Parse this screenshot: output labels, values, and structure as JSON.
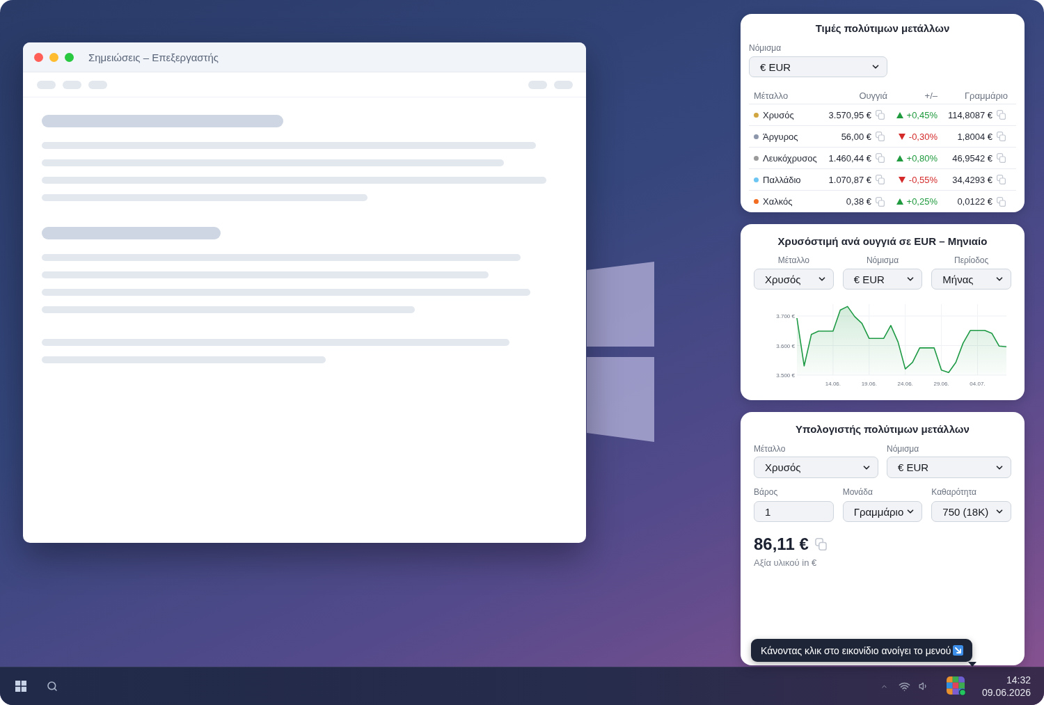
{
  "window": {
    "title": "Σημειώσεις – Επεξεργαστής"
  },
  "prices": {
    "title": "Τιμές πολύτιμων μετάλλων",
    "currency": {
      "label": "Νόμισμα",
      "value": "€ EUR"
    },
    "columns": [
      "Μέταλλο",
      "Ουγγιά",
      "+/–",
      "Γραμμάριο"
    ],
    "rows": [
      {
        "metal": "Χρυσός",
        "color": "#d1a640",
        "ounce": "3.570,95 €",
        "kind": "up",
        "change": "+0,45%",
        "gram": "114,8087 €"
      },
      {
        "metal": "Άργυρος",
        "color": "#8d97ab",
        "ounce": "56,00 €",
        "kind": "down",
        "change": "-0,30%",
        "gram": "1,8004 €"
      },
      {
        "metal": "Λευκόχρυσος",
        "color": "#9b9b9b",
        "ounce": "1.460,44 €",
        "kind": "up",
        "change": "+0,80%",
        "gram": "46,9542 €"
      },
      {
        "metal": "Παλλάδιο",
        "color": "#6cc5f2",
        "ounce": "1.070,87 €",
        "kind": "down",
        "change": "-0,55%",
        "gram": "34,4293 €"
      },
      {
        "metal": "Χαλκός",
        "color": "#f26d21",
        "ounce": "0,38 €",
        "kind": "up",
        "change": "+0,25%",
        "gram": "0,0122 €"
      }
    ]
  },
  "gold_chart": {
    "title": "Χρυσόστιμή ανά ουγγιά σε EUR – Μηνιαίο",
    "filters": [
      {
        "label": "Μέταλλο",
        "value": "Χρυσός"
      },
      {
        "label": "Νόμισμα",
        "value": "€ EUR"
      },
      {
        "label": "Περίοδος",
        "value": "Μήνας"
      }
    ],
    "chart_data": {
      "type": "area",
      "categories": [
        null,
        null,
        null,
        null,
        null,
        "14.06.",
        null,
        null,
        null,
        null,
        "19.06.",
        null,
        null,
        null,
        null,
        "24.06.",
        null,
        null,
        null,
        null,
        "29.06.",
        null,
        null,
        null,
        null,
        "04.07.",
        null,
        null,
        null,
        null
      ],
      "series": [
        {
          "color": "#1e9a45",
          "values": [
            3693,
            3531,
            3638,
            3649,
            3649,
            3649,
            3720,
            3732,
            3698,
            3675,
            3624,
            3624,
            3624,
            3668,
            3612,
            3521,
            3543,
            3592,
            3592,
            3592,
            3517,
            3509,
            3543,
            3608,
            3651,
            3651,
            3651,
            3641,
            3598,
            3596
          ]
        }
      ],
      "ylim": [
        3500,
        3740
      ],
      "yticks": [
        {
          "value": 3500,
          "label": "3.500 €"
        },
        {
          "value": 3600,
          "label": "3.600 €"
        },
        {
          "value": 3700,
          "label": "3.700 €"
        }
      ],
      "grid": true
    }
  },
  "calculator": {
    "title": "Υπολογιστής πολύτιμων μετάλλων",
    "field_rows": [
      {
        "fields": [
          {
            "kind": "select",
            "label": "Μέταλλο",
            "value": "Χρυσός"
          },
          {
            "kind": "select",
            "label": "Νόμισμα",
            "value": "€ EUR"
          }
        ]
      },
      {
        "fields": [
          {
            "kind": "input",
            "label": "Βάρος",
            "value": "1"
          },
          {
            "kind": "select",
            "label": "Μονάδα",
            "value": "Γραμμάριο"
          },
          {
            "kind": "select",
            "label": "Καθαρότητα",
            "value": "750 (18K)"
          }
        ]
      }
    ],
    "result": "86,11 €",
    "caption": "Αξία υλικού in €"
  },
  "tooltip": {
    "text": "Κάνοντας κλικ στο εικονίδιο ανοίγει το μενού"
  },
  "taskbar": {
    "time": "14:32",
    "date": "09.06.2026"
  }
}
